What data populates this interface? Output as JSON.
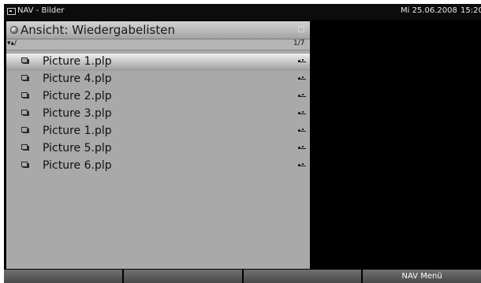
{
  "title_bar": {
    "title": "NAV - Bilder",
    "date": "Mi 25.06.2008",
    "time": "15:20"
  },
  "browser": {
    "view_label": "Ansicht: Wiedergabelisten",
    "path": "▾▴/",
    "page_indicator": "1/7",
    "selected_index": 0,
    "files": [
      {
        "name": "Picture 1.plp",
        "icon": "playlist-icon",
        "source_icon": "usb-icon"
      },
      {
        "name": "Picture 4.plp",
        "icon": "playlist-icon",
        "source_icon": "usb-icon"
      },
      {
        "name": "Picture 2.plp",
        "icon": "playlist-icon",
        "source_icon": "usb-icon"
      },
      {
        "name": "Picture 3.plp",
        "icon": "playlist-icon",
        "source_icon": "usb-icon"
      },
      {
        "name": "Picture 1.plp",
        "icon": "playlist-icon",
        "source_icon": "usb-icon"
      },
      {
        "name": "Picture 5.plp",
        "icon": "playlist-icon",
        "source_icon": "usb-icon"
      },
      {
        "name": "Picture 6.plp",
        "icon": "playlist-icon",
        "source_icon": "usb-icon"
      }
    ]
  },
  "footer": {
    "keys": [
      "",
      "",
      "",
      "NAV Menü"
    ]
  },
  "colors": {
    "screen_bg": "#000000",
    "panel_bg": "#a9a9a9",
    "softkey_bg": "#5a5a5a"
  }
}
